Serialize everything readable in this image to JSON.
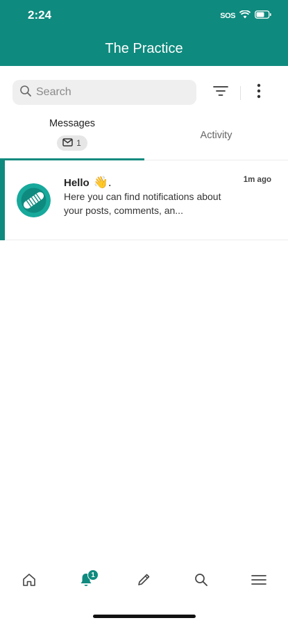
{
  "status_bar": {
    "time": "2:24",
    "sos": "SOS"
  },
  "header": {
    "title": "The Practice"
  },
  "search": {
    "placeholder": "Search",
    "value": ""
  },
  "tabs": [
    {
      "label": "Messages",
      "badge_count": "1",
      "selected": true
    },
    {
      "label": "Activity",
      "selected": false
    }
  ],
  "messages": [
    {
      "title": "Hello",
      "emoji": "👋.",
      "time": "1m ago",
      "preview": "Here you can find notifications about your posts, comments, an..."
    }
  ],
  "bottom_nav": {
    "items": [
      {
        "icon": "home-icon"
      },
      {
        "icon": "bell-icon",
        "badge": "1",
        "active": true
      },
      {
        "icon": "pencil-icon"
      },
      {
        "icon": "search-icon"
      },
      {
        "icon": "menu-icon"
      }
    ]
  },
  "colors": {
    "brand": "#0f8a7e",
    "background": "#ffffff",
    "search_bg": "#efefef"
  }
}
